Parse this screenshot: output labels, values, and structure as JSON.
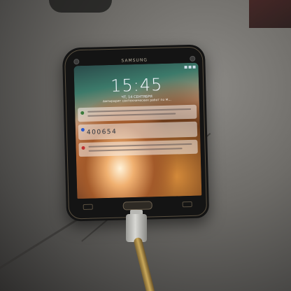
{
  "scene": {
    "description_note": "",
    "device": {
      "brand": "SAMSUNG",
      "lockscreen": {
        "time": "15:45",
        "date": "ЧТ, 14 СЕНТЯБРЯ",
        "subline": "Ампирарит сантехнических работ по М...",
        "verification_code": "400654"
      }
    },
    "colors": {
      "table": "#6e6c68",
      "phone_body": "#141414",
      "cable": "#c9a85a",
      "plug": "#d8d8d4"
    }
  }
}
